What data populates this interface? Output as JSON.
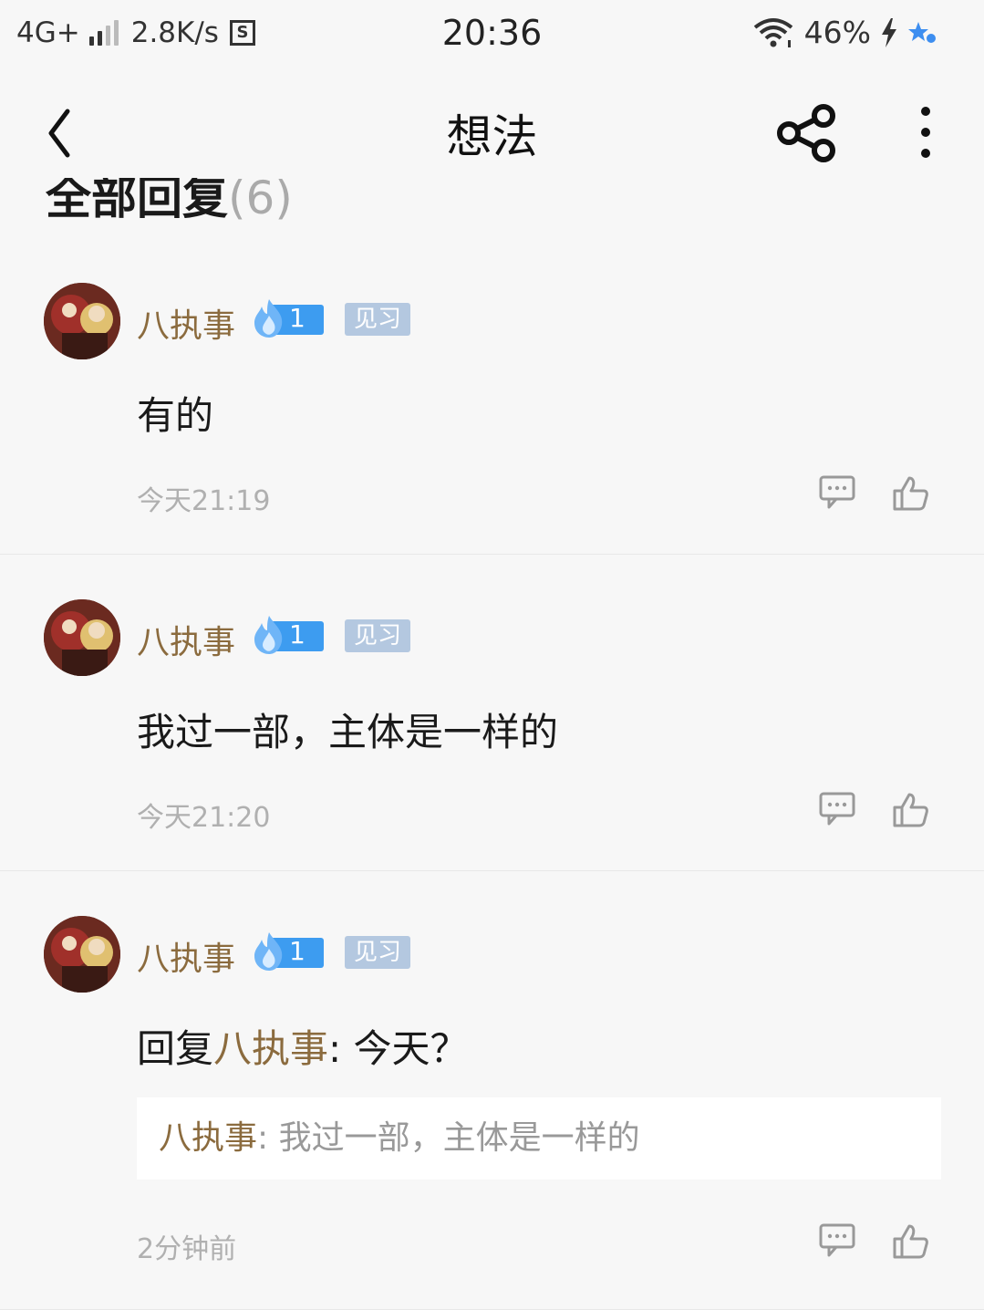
{
  "status_bar": {
    "network": "4G+",
    "speed": "2.8K/s",
    "data_icon_glyph": "S",
    "time": "20:36",
    "battery": "46%"
  },
  "nav": {
    "title": "想法",
    "back_icon": "chevron-left-icon",
    "share_icon": "share-icon",
    "more_icon": "more-vertical-icon"
  },
  "section": {
    "title": "全部回复",
    "count": "(6)"
  },
  "colors": {
    "username": "#8b6b3e",
    "fire_badge": "#3d9cf0",
    "level_badge": "#b4c8e0",
    "background": "#f7f7f7"
  },
  "comments": [
    {
      "username": "八执事",
      "fire_level": "1",
      "level_label": "见习",
      "content": "有的",
      "time": "今天21:19"
    },
    {
      "username": "八执事",
      "fire_level": "1",
      "level_label": "见习",
      "content": "我过一部，主体是一样的",
      "time": "今天21:20"
    },
    {
      "username": "八执事",
      "fire_level": "1",
      "level_label": "见习",
      "reply_prefix": "回复",
      "reply_to": "八执事",
      "reply_text": ": 今天？",
      "quote_name": "八执事",
      "quote_text": ": 我过一部，主体是一样的",
      "time": "2分钟前"
    }
  ]
}
